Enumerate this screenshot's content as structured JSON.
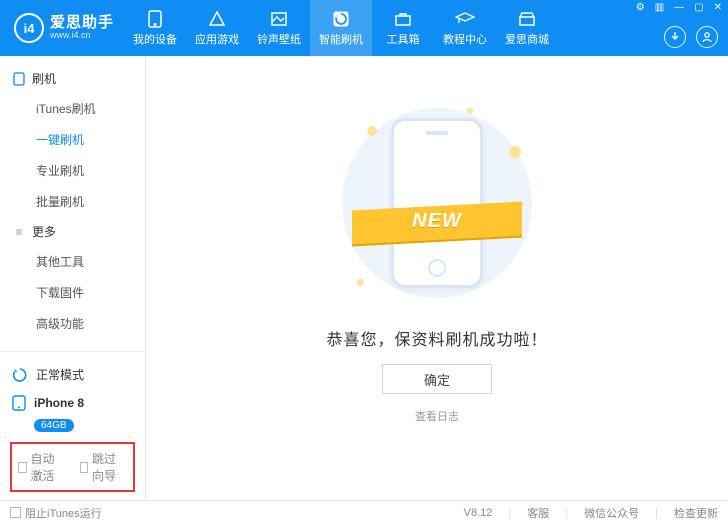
{
  "brand": {
    "name": "爱思助手",
    "sub": "www.i4.cn",
    "logo": "i4"
  },
  "nav": {
    "items": [
      {
        "label": "我的设备"
      },
      {
        "label": "应用游戏"
      },
      {
        "label": "铃声壁纸"
      },
      {
        "label": "智能刷机"
      },
      {
        "label": "工具箱"
      },
      {
        "label": "教程中心"
      },
      {
        "label": "爱思商城"
      }
    ],
    "active_index": 3
  },
  "sidebar": {
    "group1": {
      "title": "刷机",
      "items": [
        "iTunes刷机",
        "一键刷机",
        "专业刷机",
        "批量刷机"
      ],
      "active_index": 1
    },
    "group2": {
      "title": "更多",
      "items": [
        "其他工具",
        "下载固件",
        "高级功能"
      ]
    },
    "mode_label": "正常模式",
    "device_name": "iPhone 8",
    "storage": "64GB",
    "checkbox1": "自动激活",
    "checkbox2": "跳过向导"
  },
  "main": {
    "ribbon_text": "NEW",
    "congrats_message": "恭喜您，保资料刷机成功啦！",
    "ok_button": "确定",
    "view_log": "查看日志"
  },
  "statusbar": {
    "block_itunes": "阻止iTunes运行",
    "version": "V8.12",
    "help": "客服",
    "wechat": "微信公众号",
    "check_update": "检查更新"
  }
}
